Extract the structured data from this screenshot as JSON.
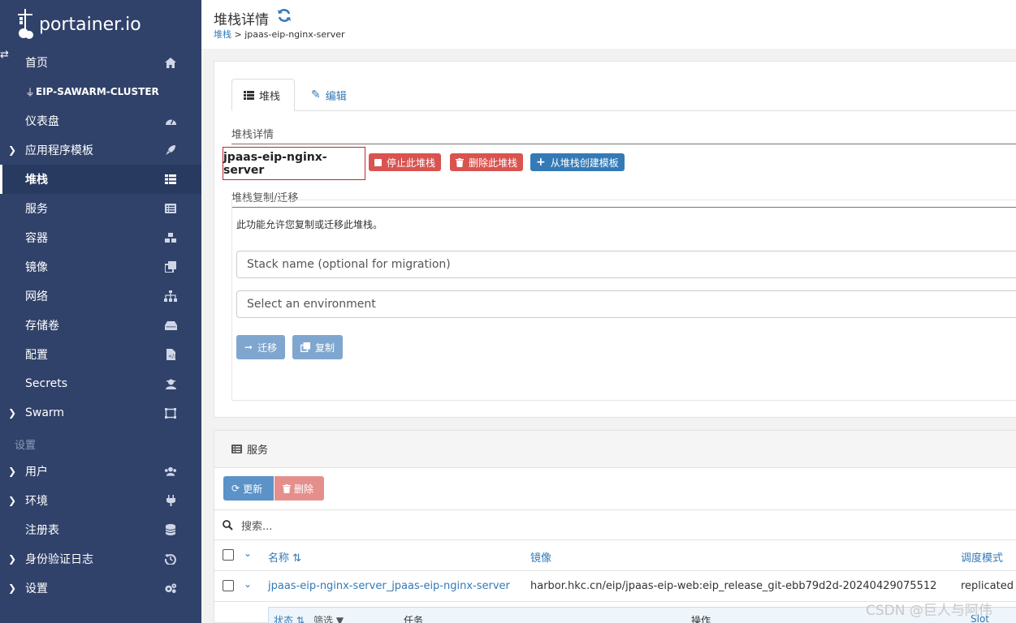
{
  "brand": {
    "name": "portainer.io"
  },
  "sidebar": {
    "items": [
      {
        "label": "首页",
        "icon": "home-icon"
      },
      {
        "label": "EIP-SAWARM-CLUSTER",
        "icon": "plug-icon"
      },
      {
        "label": "仪表盘",
        "icon": "dashboard-icon"
      },
      {
        "label": "应用程序模板",
        "icon": "rocket-icon"
      },
      {
        "label": "堆栈",
        "icon": "th-list-icon"
      },
      {
        "label": "服务",
        "icon": "list-alt-icon"
      },
      {
        "label": "容器",
        "icon": "cubes-icon"
      },
      {
        "label": "镜像",
        "icon": "clone-icon"
      },
      {
        "label": "网络",
        "icon": "sitemap-icon"
      },
      {
        "label": "存储卷",
        "icon": "hdd-icon"
      },
      {
        "label": "配置",
        "icon": "file-code-icon"
      },
      {
        "label": "Secrets",
        "icon": "user-secret-icon"
      },
      {
        "label": "Swarm",
        "icon": "object-group-icon"
      },
      {
        "label": "用户",
        "icon": "users-icon"
      },
      {
        "label": "环境",
        "icon": "plug-icon"
      },
      {
        "label": "注册表",
        "icon": "database-icon"
      },
      {
        "label": "身份验证日志",
        "icon": "history-icon"
      },
      {
        "label": "设置",
        "icon": "cogs-icon"
      }
    ],
    "section_settings": "设置"
  },
  "header": {
    "title": "堆栈详情",
    "breadcrumb_link": "堆栈",
    "breadcrumb_sep": " > ",
    "breadcrumb_current": "jpaas-eip-nginx-server"
  },
  "tabs": {
    "stack": "堆栈",
    "edit": "编辑"
  },
  "details": {
    "heading": "堆栈详情",
    "stack_name": "jpaas-eip-nginx-server",
    "stop_button": "停止此堆栈",
    "delete_button": "删除此堆栈",
    "template_button": "从堆栈创建模板"
  },
  "migration": {
    "heading": "堆栈复制/迁移",
    "description": "此功能允许您复制或迁移此堆栈。",
    "name_placeholder": "Stack name (optional for migration)",
    "env_select": "Select an environment",
    "migrate_button": "迁移",
    "copy_button": "复制"
  },
  "services": {
    "title": "服务",
    "update_button": "更新",
    "delete_button": "删除",
    "search_placeholder": "搜索...",
    "columns": {
      "name": "名称",
      "image": "镜像",
      "mode": "调度模式"
    },
    "rows": [
      {
        "name": "jpaas-eip-nginx-server_jpaas-eip-nginx-server",
        "image": "harbor.hkc.cn/eip/jpaas-eip-web:eip_release_git-ebb79d2d-20240429075512",
        "mode": "replicated"
      }
    ],
    "task_columns": {
      "status": "状态",
      "filter": "筛选",
      "task": "任务",
      "actions": "操作",
      "slot": "Slot"
    }
  },
  "watermark": "CSDN @巨人与阿伟",
  "colors": {
    "sidebar": "#30426a",
    "primary": "#337ab7",
    "danger": "#d9534f"
  }
}
